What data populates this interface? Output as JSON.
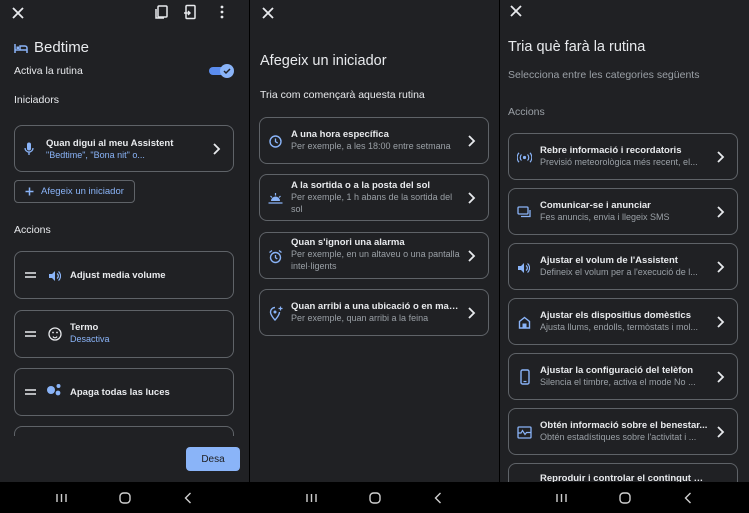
{
  "panel1": {
    "title": "Bedtime",
    "activate_label": "Activa la rutina",
    "starters_heading": "Iniciadors",
    "starter": {
      "title": "Quan digui al meu Assistent",
      "sub": "\"Bedtime\", \"Bona nit\" o..."
    },
    "add_starter": "Afegeix un iniciador",
    "actions_heading": "Accions",
    "actions": [
      {
        "title": "Adjust media volume",
        "sub": ""
      },
      {
        "title": "Termo",
        "sub": "Desactiva"
      },
      {
        "title": "Apaga todas las luces",
        "sub": ""
      }
    ],
    "save_label": "Desa"
  },
  "panel2": {
    "title": "Afegeix un iniciador",
    "subtitle": "Tria com començarà aquesta rutina",
    "options": [
      {
        "title": "A una hora específica",
        "sub": "Per exemple, a les 18:00 entre setmana"
      },
      {
        "title": "A la sortida o a la posta del sol",
        "sub": "Per exemple, 1 h abans de la sortida del sol"
      },
      {
        "title": "Quan s'ignori una alarma",
        "sub": "Per exemple, en un altaveu o una pantalla intel·ligents"
      },
      {
        "title": "Quan arribi a una ubicació o en marxi",
        "sub": "Per exemple, quan arribi a la feina"
      }
    ]
  },
  "panel3": {
    "title": "Tria què farà la rutina",
    "subtitle": "Selecciona entre les categories següents",
    "section": "Accions",
    "categories": [
      {
        "title": "Rebre informació i recordatoris",
        "sub": "Previsió meteorològica més recent, el..."
      },
      {
        "title": "Comunicar-se i anunciar",
        "sub": "Fes anuncis, envia i llegeix SMS"
      },
      {
        "title": "Ajustar el volum de l'Assistent",
        "sub": "Defineix el volum per a l'execució de l..."
      },
      {
        "title": "Ajustar els dispositius domèstics",
        "sub": "Ajusta llums, endolls, termòstats i mol..."
      },
      {
        "title": "Ajustar la configuració del telèfon",
        "sub": "Silencia el timbre, activa el mode No ..."
      },
      {
        "title": "Obtén informació sobre el benestar...",
        "sub": "Obtén estadístiques sobre l'activitat i ..."
      },
      {
        "title": "Reproduir i controlar el contingut mu...",
        "sub": ""
      }
    ]
  },
  "colors": {
    "accent": "#8ab4f8",
    "toggle_track": "#5b8def",
    "bg": "#202124",
    "border": "#5f6368"
  }
}
